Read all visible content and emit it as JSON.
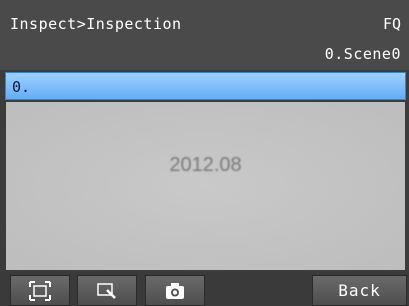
{
  "header": {
    "breadcrumb": "Inspect>Inspection",
    "model": "FQ",
    "scene": "0.Scene0"
  },
  "selection": {
    "item_label": "0."
  },
  "image_view": {
    "captured_text": "2012.08"
  },
  "toolbar": {
    "fit_icon": "fit-screen-icon",
    "zoom_icon": "zoom-icon",
    "camera_icon": "camera-icon",
    "back_label": "Back"
  },
  "colors": {
    "header_bg": "#4a4a4a",
    "selection_bar": "#62aef5",
    "image_bg": "#c2c2c2"
  }
}
